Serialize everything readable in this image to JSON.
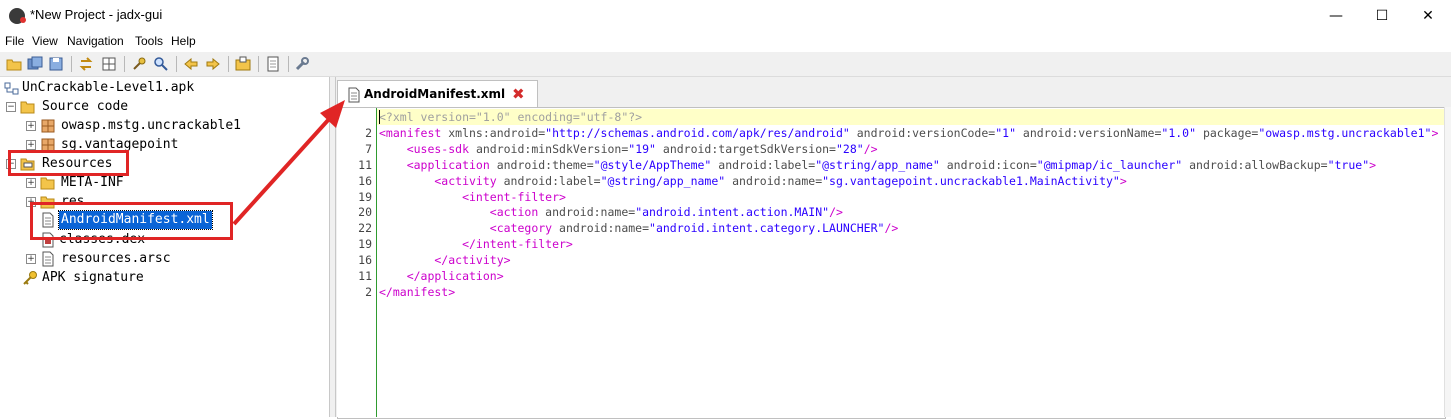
{
  "window": {
    "title": "*New Project - jadx-gui",
    "app_icon_text": "jadx",
    "controls": {
      "minimize": "—",
      "maximize": "☐",
      "close": "✕"
    }
  },
  "menu": {
    "file": "File",
    "view": "View",
    "navigation": "Navigation",
    "tools": "Tools",
    "help": "Help"
  },
  "toolbar": {
    "icons": [
      "open-file-icon",
      "save-all-icon",
      "export-icon",
      "sync-icon",
      "flatten-packages-icon",
      "text-search-icon",
      "class-search-icon",
      "back-icon",
      "forward-icon",
      "deobfuscation-icon",
      "log-viewer-icon",
      "preferences-icon"
    ]
  },
  "tree": {
    "root": "UnCrackable-Level1.apk",
    "source_code": "Source code",
    "pkg1": "owasp.mstg.uncrackable1",
    "pkg2": "sg.vantagepoint",
    "resources": "Resources",
    "meta_inf": "META-INF",
    "res": "res",
    "manifest": "AndroidManifest.xml",
    "classes": "classes.dex",
    "arsc": "resources.arsc",
    "signature": "APK signature"
  },
  "editor": {
    "tab_label": "AndroidManifest.xml",
    "tab_close": "✖",
    "line_numbers": [
      "",
      "2",
      "7",
      "11",
      "16",
      "19",
      "20",
      "22",
      "19",
      "16",
      "11",
      "2"
    ],
    "lines": [
      [
        {
          "t": "<?xml version=\"1.0\" encoding=\"utf-8\"?>",
          "c": "pi"
        }
      ],
      [
        {
          "t": "<manifest",
          "c": "tag"
        },
        {
          "t": " xmlns:android=",
          "c": "attr"
        },
        {
          "t": "\"http://schemas.android.com/apk/res/android\"",
          "c": "val"
        },
        {
          "t": " android:versionCode=",
          "c": "attr"
        },
        {
          "t": "\"1\"",
          "c": "val"
        },
        {
          "t": " android:versionName=",
          "c": "attr"
        },
        {
          "t": "\"1.0\"",
          "c": "val"
        },
        {
          "t": " package=",
          "c": "attr"
        },
        {
          "t": "\"owasp.mstg.uncrackable1\"",
          "c": "val"
        },
        {
          "t": ">",
          "c": "tag"
        }
      ],
      [
        {
          "t": "    <uses-sdk",
          "c": "tag"
        },
        {
          "t": " android:minSdkVersion=",
          "c": "attr"
        },
        {
          "t": "\"19\"",
          "c": "val"
        },
        {
          "t": " android:targetSdkVersion=",
          "c": "attr"
        },
        {
          "t": "\"28\"",
          "c": "val"
        },
        {
          "t": "/>",
          "c": "tag"
        }
      ],
      [
        {
          "t": "    <application",
          "c": "tag"
        },
        {
          "t": " android:theme=",
          "c": "attr"
        },
        {
          "t": "\"@style/AppTheme\"",
          "c": "val"
        },
        {
          "t": " android:label=",
          "c": "attr"
        },
        {
          "t": "\"@string/app_name\"",
          "c": "val"
        },
        {
          "t": " android:icon=",
          "c": "attr"
        },
        {
          "t": "\"@mipmap/ic_launcher\"",
          "c": "val"
        },
        {
          "t": " android:allowBackup=",
          "c": "attr"
        },
        {
          "t": "\"true\"",
          "c": "val"
        },
        {
          "t": ">",
          "c": "tag"
        }
      ],
      [
        {
          "t": "        <activity",
          "c": "tag"
        },
        {
          "t": " android:label=",
          "c": "attr"
        },
        {
          "t": "\"@string/app_name\"",
          "c": "val"
        },
        {
          "t": " android:name=",
          "c": "attr"
        },
        {
          "t": "\"sg.vantagepoint.uncrackable1.MainActivity\"",
          "c": "val"
        },
        {
          "t": ">",
          "c": "tag"
        }
      ],
      [
        {
          "t": "            <intent-filter>",
          "c": "tag"
        }
      ],
      [
        {
          "t": "                <action",
          "c": "tag"
        },
        {
          "t": " android:name=",
          "c": "attr"
        },
        {
          "t": "\"android.intent.action.MAIN\"",
          "c": "val"
        },
        {
          "t": "/>",
          "c": "tag"
        }
      ],
      [
        {
          "t": "                <category",
          "c": "tag"
        },
        {
          "t": " android:name=",
          "c": "attr"
        },
        {
          "t": "\"android.intent.category.LAUNCHER\"",
          "c": "val"
        },
        {
          "t": "/>",
          "c": "tag"
        }
      ],
      [
        {
          "t": "            </intent-filter>",
          "c": "tag"
        }
      ],
      [
        {
          "t": "        </activity>",
          "c": "tag"
        }
      ],
      [
        {
          "t": "    </application>",
          "c": "tag"
        }
      ],
      [
        {
          "t": "</manifest>",
          "c": "tag"
        }
      ]
    ]
  },
  "colors": {
    "tag": "#cc00cc",
    "attr": "#4d4d4d",
    "val": "#2a00ff",
    "pi": "#a0a0a0",
    "selection": "#0a64d6",
    "annotation_red": "#e02525",
    "current_line": "#ffffc8"
  }
}
